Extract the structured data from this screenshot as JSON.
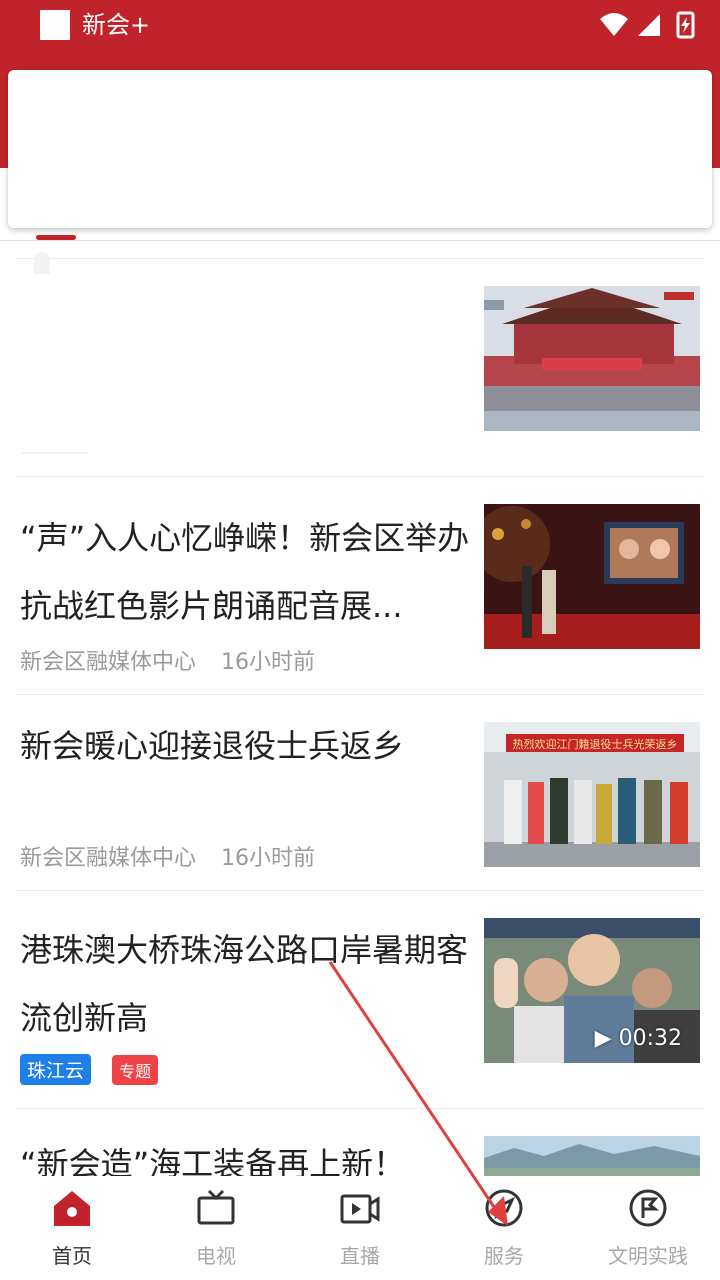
{
  "status_bar": {
    "app_title": "新会+"
  },
  "news": [
    {
      "title": "",
      "source": "",
      "time": ""
    },
    {
      "title": "“声”入人心忆峥嵘！新会区举办抗战红色影片朗诵配音展...",
      "source": "新会区融媒体中心",
      "time": "16小时前"
    },
    {
      "title": "新会暖心迎接退役士兵返乡",
      "source": "新会区融媒体中心",
      "time": "16小时前"
    },
    {
      "title": "港珠澳大桥珠海公路口岸暑期客流创新高",
      "badges": [
        "珠江云",
        "专题"
      ],
      "video_duration": "00:32"
    },
    {
      "title": "“新会造”海工装备再上新！"
    }
  ],
  "thumb_texts": {
    "banner": "热烈欢迎江门籍退役士兵光荣返乡"
  },
  "tabbar": [
    {
      "label": "首页",
      "icon": "home-icon",
      "active": true
    },
    {
      "label": "电视",
      "icon": "tv-icon",
      "active": false
    },
    {
      "label": "直播",
      "icon": "live-video-icon",
      "active": false
    },
    {
      "label": "服务",
      "icon": "compass-icon",
      "active": false
    },
    {
      "label": "文明实践",
      "icon": "flag-circle-icon",
      "active": false
    }
  ],
  "colors": {
    "brand_red": "#c1232a",
    "badge_blue": "#1e7fe6",
    "badge_red": "#ef4349"
  }
}
